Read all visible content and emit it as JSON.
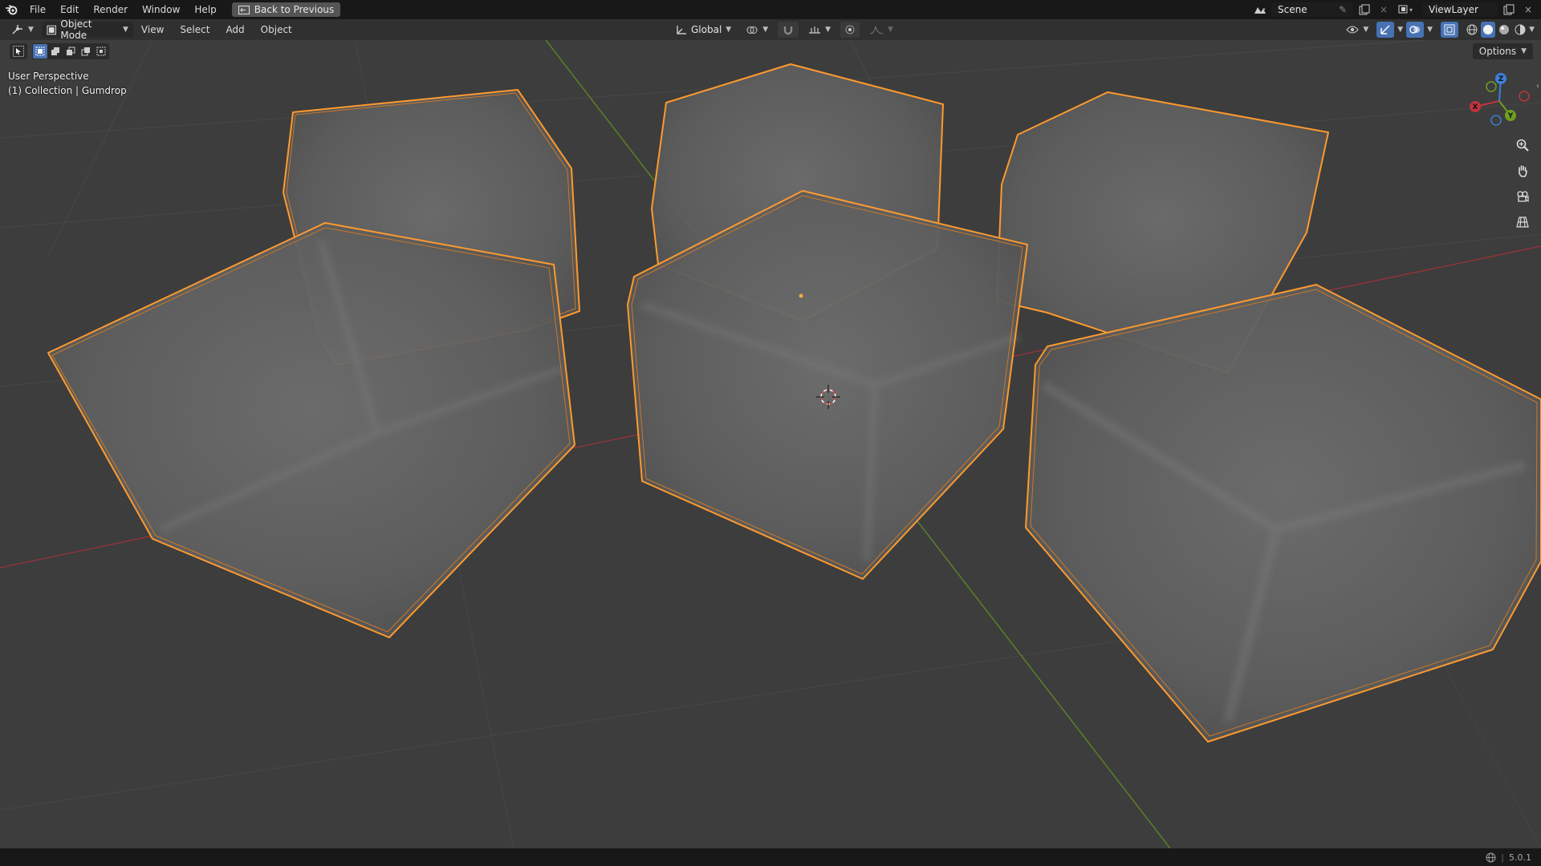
{
  "topbar": {
    "menu": [
      "File",
      "Edit",
      "Render",
      "Window",
      "Help"
    ],
    "back_button": "Back to Previous",
    "scene_name": "Scene",
    "view_layer": "ViewLayer"
  },
  "header": {
    "mode": "Object Mode",
    "menus": [
      "View",
      "Select",
      "Add",
      "Object"
    ],
    "transform_orientation": "Global"
  },
  "viewport": {
    "perspective_label": "User Perspective",
    "collection_label": "(1) Collection | Gumdrop",
    "options_label": "Options",
    "axis_labels": {
      "x": "X",
      "y": "Y",
      "z": "Z"
    },
    "colors": {
      "selection_outline": "#ff9a2e",
      "x_axis": "#c0353d",
      "y_axis": "#6e9e22",
      "z_axis": "#3b7fd6",
      "background": "#3d3d3d"
    }
  },
  "statusbar": {
    "version": "5.0.1"
  }
}
